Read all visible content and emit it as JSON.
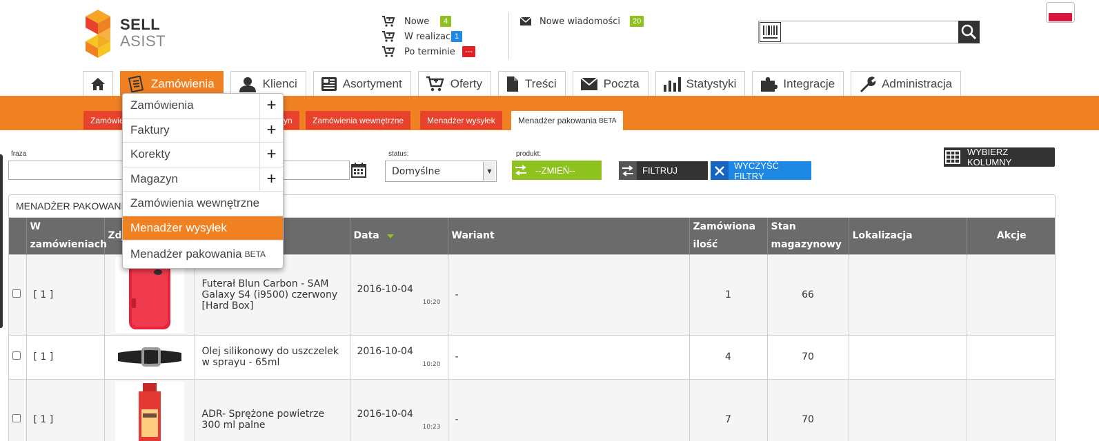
{
  "logo": {
    "line1": "SELL",
    "line2": "ASIST"
  },
  "header": {
    "stats": [
      {
        "label": "Nowe",
        "count": "4",
        "color": "#8dc21f"
      },
      {
        "label": "W realizacji",
        "count": "1",
        "color": "#1e88e5"
      },
      {
        "label": "Po terminie",
        "count": "---",
        "color": "#e31e24"
      }
    ],
    "messages": {
      "label": "Nowe wiadomości",
      "count": "20",
      "color": "#8dc21f"
    },
    "search": {
      "value": "",
      "placeholder": ""
    },
    "language": "pl"
  },
  "nav": {
    "items": [
      {
        "label": "Zamówienia",
        "icon": "orders-icon",
        "active": true
      },
      {
        "label": "Klienci",
        "icon": "user-icon"
      },
      {
        "label": "Asortyment",
        "icon": "catalog-icon"
      },
      {
        "label": "Oferty",
        "icon": "cart-icon"
      },
      {
        "label": "Treści",
        "icon": "document-icon"
      },
      {
        "label": "Poczta",
        "icon": "envelope-icon"
      },
      {
        "label": "Statystyki",
        "icon": "bar-chart-icon"
      },
      {
        "label": "Integracje",
        "icon": "puzzle-icon"
      },
      {
        "label": "Administracja",
        "icon": "wrench-icon"
      }
    ]
  },
  "subtabs": {
    "t1": "Zamówie",
    "t2": "yn",
    "t3": "Zamówienia wewnętrzne",
    "t4": "Menadżer wysyłek",
    "t5": "Menadżer pakowania",
    "t5_sup": "BETA"
  },
  "dropdown": {
    "items": [
      {
        "label": "Zamówienia",
        "plus": "+"
      },
      {
        "label": "Faktury",
        "plus": "+"
      },
      {
        "label": "Korekty",
        "plus": "+"
      },
      {
        "label": "Magazyn",
        "plus": "+"
      },
      {
        "label": "Zamówienia wewnętrzne"
      },
      {
        "label": "Menadżer wysyłek",
        "active": true
      },
      {
        "label": "Menadżer pakowania",
        "sup": "BETA"
      }
    ]
  },
  "filters": {
    "fraza_label": "fraza",
    "fraza_value": "",
    "status_label": "status:",
    "status_value": "Domyślne",
    "produkt_label": "produkt:",
    "zmien": "--ZMIEŃ--",
    "filtruj": "FILTRUJ",
    "wyczysc": "WYCZYŚĆ FILTRY",
    "wybierz": "WYBIERZ KOLUMNY"
  },
  "panel": {
    "title": "MENADŻER PAKOWANIA",
    "headers": {
      "w_zam": "W zamówieniach",
      "zdjecie": "Zdj",
      "nazwa": "",
      "data": "Data",
      "wariant": "Wariant",
      "ilosc": "Zamówiona ilość",
      "stan": "Stan magazynowy",
      "lokalizacja": "Lokalizacja",
      "akcje": "Akcje"
    },
    "rows": [
      {
        "w_zam": "[ 1 ]",
        "name": "Futerał Blun Carbon - SAM Galaxy S4 (i9500) czerwony [Hard Box]",
        "date": "2016-10-04",
        "time": "10:20",
        "variant": "-",
        "qty": "1",
        "stock": "66",
        "location": ""
      },
      {
        "w_zam": "[ 1 ]",
        "name": "Olej silikonowy do uszczelek w sprayu - 65ml",
        "date": "2016-10-04",
        "time": "10:20",
        "variant": "-",
        "qty": "4",
        "stock": "70",
        "location": ""
      },
      {
        "w_zam": "[ 1 ]",
        "name": "ADR- Sprężone powietrze 300 ml palne",
        "date": "2016-10-04",
        "time": "10:23",
        "variant": "-",
        "qty": "7",
        "stock": "70",
        "location": ""
      }
    ]
  }
}
